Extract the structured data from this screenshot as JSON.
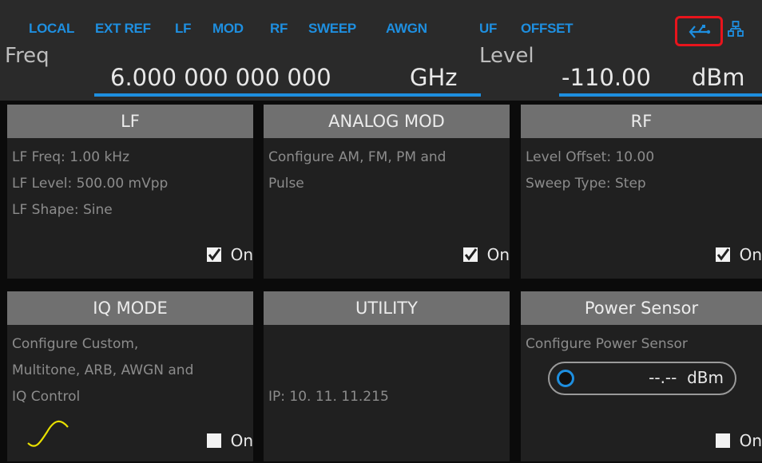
{
  "status_bar": {
    "items": [
      "LOCAL",
      "EXT REF",
      "LF",
      "MOD",
      "RF",
      "SWEEP",
      "AWGN",
      "UF",
      "OFFSET"
    ],
    "icons": [
      "usb-icon",
      "network-icon"
    ]
  },
  "freq": {
    "label": "Freq",
    "value": "6.000 000 000 000",
    "unit": "GHz"
  },
  "level": {
    "label": "Level",
    "value": "-110.00",
    "unit": "dBm"
  },
  "tiles": [
    {
      "title": "LF",
      "lines": [
        "LF Freq: 1.00 kHz",
        "LF Level: 500.00 mVpp",
        "LF Shape: Sine"
      ],
      "on_label": "On",
      "checked": true
    },
    {
      "title": "ANALOG MOD",
      "lines": [
        "Configure AM, FM, PM and",
        "Pulse"
      ],
      "on_label": "On",
      "checked": true
    },
    {
      "title": "RF",
      "lines": [
        "Level Offset: 10.00",
        "Sweep Type: Step"
      ],
      "on_label": "On",
      "checked": true
    },
    {
      "title": "IQ MODE",
      "lines": [
        "Configure Custom,",
        "Multitone, ARB, AWGN and",
        "IQ Control"
      ],
      "on_label": "On",
      "checked": false
    },
    {
      "title": "UTILITY",
      "lines": [
        "IP:  10. 11. 11.215"
      ]
    },
    {
      "title": "Power Sensor",
      "lines": [
        "Configure Power Sensor"
      ],
      "sensor_value": "--.--",
      "sensor_unit": "dBm",
      "on_label": "On",
      "checked": false
    }
  ],
  "colors": {
    "accent": "#1e8fe0",
    "highlight_box": "#e8141c",
    "sine_wave": "#e8e000"
  }
}
